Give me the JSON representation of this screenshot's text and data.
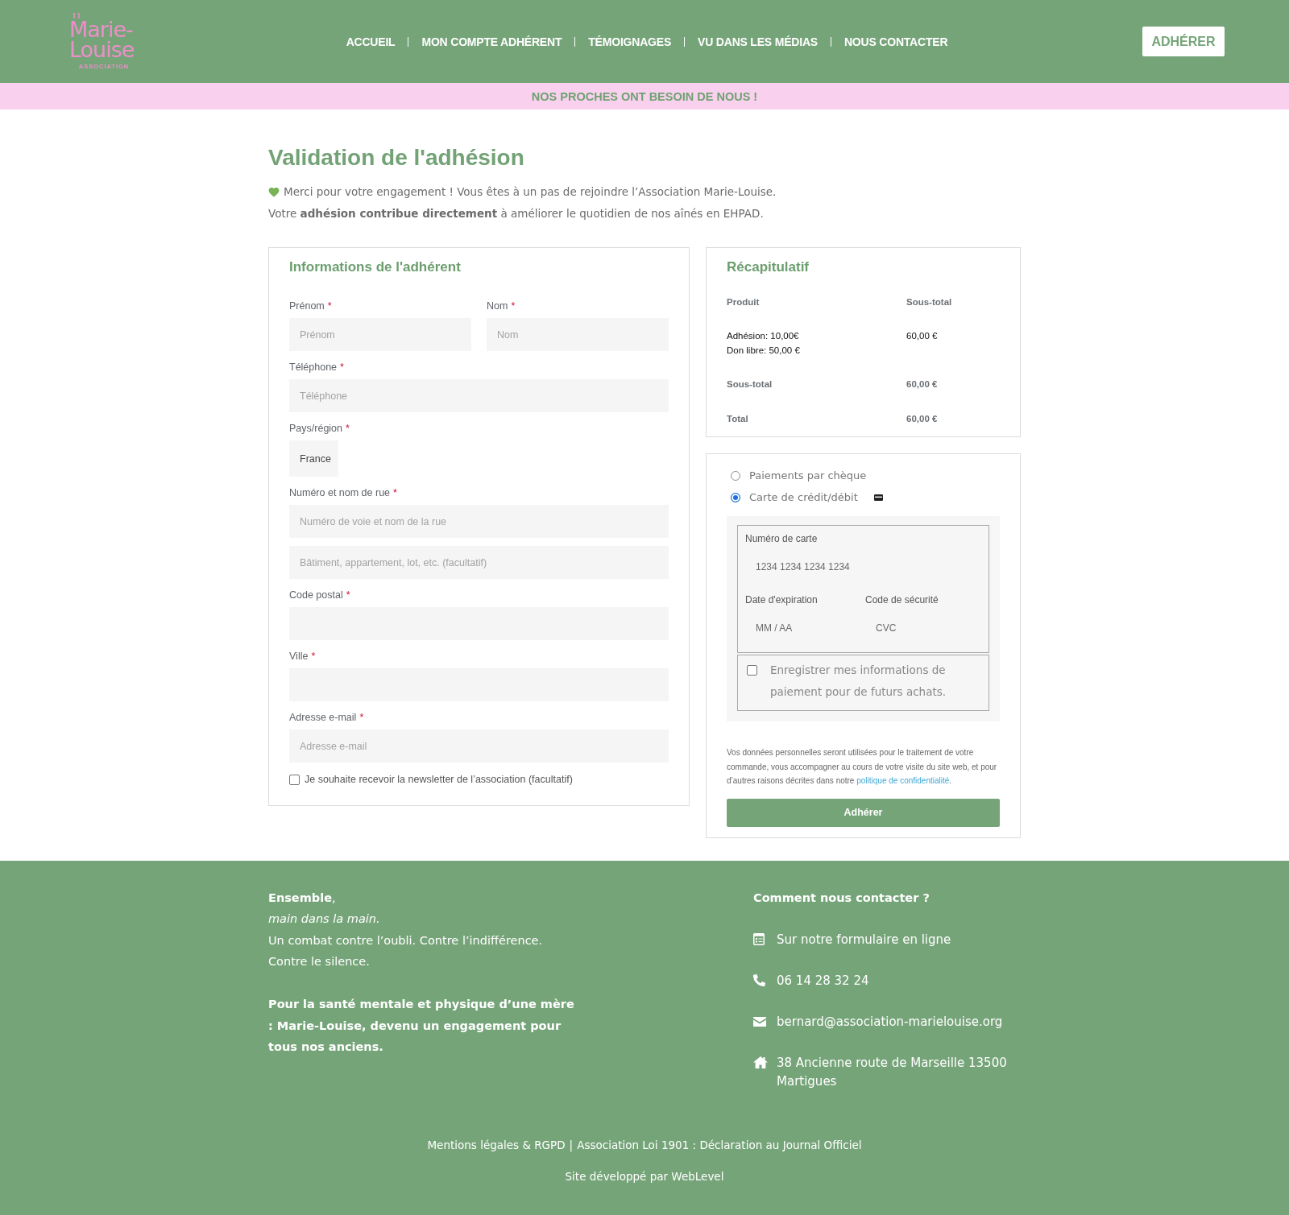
{
  "header": {
    "logo": {
      "name": "Marie-Louise",
      "tagline": "ASSOCIATION"
    },
    "nav": [
      "ACCUEIL",
      "MON COMPTE ADHÉRENT",
      "TÉMOIGNAGES",
      "VU DANS LES MÉDIAS",
      "NOUS CONTACTER"
    ],
    "cta": "ADHÉRER"
  },
  "banner": "NOS PROCHES ONT BESOIN DE NOUS !",
  "page": {
    "title": "Validation de l'adhésion",
    "thanks_line": "Merci pour votre engagement ! Vous êtes à un pas de rejoindre l’Association Marie-Louise.",
    "impact_line": "Votre **adhésion contribue directement** à améliorer le quotidien de nos aînés en EHPAD."
  },
  "member_form": {
    "title": "Informations de l'adhérent",
    "rows": [
      [
        {
          "label": "Prénom",
          "asterisk": "*",
          "inputs": [
            {
              "kind": "text",
              "placeholder": "Prénom"
            }
          ]
        },
        {
          "label": "Nom",
          "asterisk": "*",
          "inputs": [
            {
              "kind": "text",
              "placeholder": "Nom"
            }
          ]
        }
      ],
      [
        {
          "label": "Téléphone",
          "asterisk": "*",
          "inputs": [
            {
              "kind": "text",
              "placeholder": "Téléphone"
            }
          ]
        }
      ],
      [
        {
          "label": "Pays/région",
          "asterisk": "*",
          "inputs": [
            {
              "kind": "select",
              "value": "France"
            }
          ]
        }
      ],
      [
        {
          "label": "Numéro et nom de rue",
          "asterisk": "*",
          "inputs": [
            {
              "kind": "text",
              "placeholder": "Numéro de voie et nom de la rue"
            },
            {
              "kind": "text",
              "placeholder": "Bâtiment, appartement, lot, etc. (facultatif)"
            }
          ]
        }
      ],
      [
        {
          "label": "Code postal",
          "asterisk": "*",
          "inputs": [
            {
              "kind": "text"
            }
          ]
        }
      ],
      [
        {
          "label": "Ville",
          "asterisk": "*",
          "inputs": [
            {
              "kind": "text"
            }
          ]
        }
      ],
      [
        {
          "label": "Adresse e-mail",
          "asterisk": "*",
          "inputs": [
            {
              "kind": "text",
              "placeholder": "Adresse e-mail"
            }
          ]
        }
      ]
    ],
    "newsletter": {
      "label": "Je souhaite recevoir la newsletter de l’association (facultatif)",
      "checked": false
    }
  },
  "summary": {
    "title": "Récapitulatif",
    "columns": [
      "Produit",
      "Sous-total"
    ],
    "items": [
      {
        "lines": [
          "Adhésion: 10,00€",
          "Don libre: 50,00 €"
        ],
        "subtotal": "60,00 €"
      }
    ],
    "totals": [
      {
        "label": "Sous-total",
        "value": "60,00 €"
      },
      {
        "label": "Total",
        "value": "60,00 €"
      }
    ]
  },
  "payment": {
    "methods": [
      {
        "kind": "cheque",
        "label": "Paiements par chèque",
        "selected": false
      },
      {
        "kind": "card",
        "label": "Carte de crédit/débit",
        "selected": true
      }
    ],
    "card_form": {
      "number": {
        "label": "Numéro de carte",
        "placeholder": "1234 1234 1234 1234"
      },
      "expiry": {
        "label": "Date d'expiration",
        "placeholder": "MM / AA"
      },
      "cvc": {
        "label": "Code de sécurité",
        "placeholder": "CVC"
      }
    },
    "save_info": {
      "label": "Enregistrer mes informations de paiement pour de futurs achats.",
      "checked": false
    },
    "privacy": {
      "text": "Vos données personnelles seront utilisées pour le traitement de votre commande, vous accompagner au cours de votre visite du site web, et pour d’autres raisons décrites dans notre ",
      "link": "politique de confidentialité",
      "after": "."
    },
    "submit": "Adhérer"
  },
  "footer": {
    "lines": [
      {
        "kind": "plain",
        "text": "**Ensemble**,"
      },
      {
        "kind": "italic",
        "text": "main dans la main."
      },
      {
        "kind": "plain",
        "text": "Un combat contre l’oubli. Contre l’indifférence."
      },
      {
        "kind": "plain",
        "text": "Contre le silence."
      }
    ],
    "statement": "Pour la santé mentale et physique d’une mère : Marie-Louise, devenu un engagement pour tous nos anciens.",
    "contact": {
      "title": "Comment nous contacter ?",
      "items": [
        {
          "kind": "form",
          "text": "Sur notre formulaire en ligne"
        },
        {
          "kind": "phone",
          "text": "06 14 28 32 24"
        },
        {
          "kind": "email",
          "text": "bernard@association-marielouise.org"
        },
        {
          "kind": "address",
          "text": "38 Ancienne route de Marseille 13500 Martigues"
        }
      ]
    },
    "legal_links": [
      "Mentions légales & RGPD",
      "Association Loi 1901 : Déclaration au Journal Officiel"
    ],
    "separator": "|",
    "credit": "Site développé par WebLevel"
  }
}
